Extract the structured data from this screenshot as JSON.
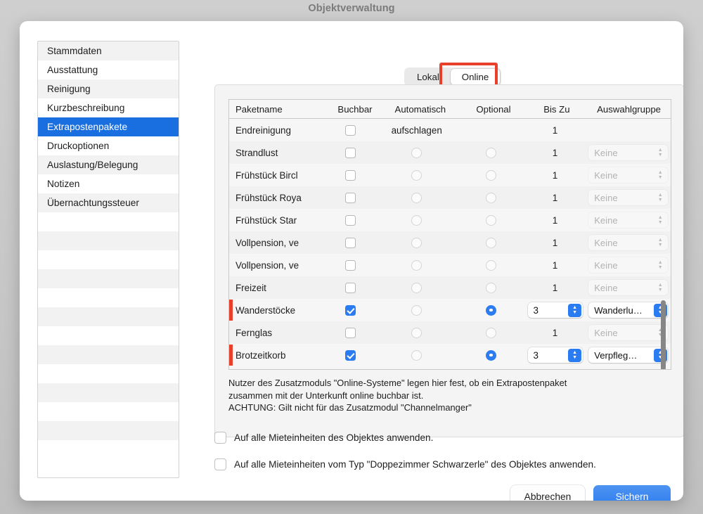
{
  "window": {
    "title": "Objektverwaltung"
  },
  "sidebar": {
    "items": [
      {
        "label": "Stammdaten",
        "selected": false
      },
      {
        "label": "Ausstattung",
        "selected": false
      },
      {
        "label": "Reinigung",
        "selected": false
      },
      {
        "label": "Kurzbeschreibung",
        "selected": false
      },
      {
        "label": "Extrapostenpakete",
        "selected": true
      },
      {
        "label": "Druckoptionen",
        "selected": false
      },
      {
        "label": "Auslastung/Belegung",
        "selected": false
      },
      {
        "label": "Notizen",
        "selected": false
      },
      {
        "label": "Übernachtungssteuer",
        "selected": false
      }
    ],
    "empty_rows": 13
  },
  "tabs": {
    "items": [
      {
        "label": "Lokal",
        "active": false
      },
      {
        "label": "Online",
        "active": true
      }
    ],
    "highlight_color": "#e8402a",
    "highlighted_tab": "Online"
  },
  "table": {
    "columns": [
      "Paketname",
      "Buchbar",
      "Automatisch",
      "Optional",
      "Bis Zu",
      "Auswahlgruppe"
    ],
    "rows": [
      {
        "name": "Endreinigung",
        "buchbar": false,
        "automatisch": "aufschlagen",
        "optional": null,
        "bis_zu": "1",
        "bis_zu_stepper": false,
        "gruppe": null,
        "gruppe_enabled": false,
        "marked": false
      },
      {
        "name": "Strandlust",
        "buchbar": false,
        "automatisch": "radio-off",
        "optional": "off",
        "bis_zu": "1",
        "bis_zu_stepper": false,
        "gruppe": "Keine",
        "gruppe_enabled": false,
        "marked": false
      },
      {
        "name": "Frühstück Bircl",
        "buchbar": false,
        "automatisch": "radio-off",
        "optional": "off",
        "bis_zu": "1",
        "bis_zu_stepper": false,
        "gruppe": "Keine",
        "gruppe_enabled": false,
        "marked": false
      },
      {
        "name": "Frühstück Roya",
        "buchbar": false,
        "automatisch": "radio-off",
        "optional": "off",
        "bis_zu": "1",
        "bis_zu_stepper": false,
        "gruppe": "Keine",
        "gruppe_enabled": false,
        "marked": false
      },
      {
        "name": "Frühstück Star",
        "buchbar": false,
        "automatisch": "radio-off",
        "optional": "off",
        "bis_zu": "1",
        "bis_zu_stepper": false,
        "gruppe": "Keine",
        "gruppe_enabled": false,
        "marked": false
      },
      {
        "name": "Vollpension, ve",
        "buchbar": false,
        "automatisch": "radio-off",
        "optional": "off",
        "bis_zu": "1",
        "bis_zu_stepper": false,
        "gruppe": "Keine",
        "gruppe_enabled": false,
        "marked": false
      },
      {
        "name": "Vollpension, ve",
        "buchbar": false,
        "automatisch": "radio-off",
        "optional": "off",
        "bis_zu": "1",
        "bis_zu_stepper": false,
        "gruppe": "Keine",
        "gruppe_enabled": false,
        "marked": false
      },
      {
        "name": "Freizeit",
        "buchbar": false,
        "automatisch": "radio-off",
        "optional": "off",
        "bis_zu": "1",
        "bis_zu_stepper": false,
        "gruppe": "Keine",
        "gruppe_enabled": false,
        "marked": false
      },
      {
        "name": "Wanderstöcke",
        "buchbar": true,
        "automatisch": "radio-off",
        "optional": "on",
        "bis_zu": "3",
        "bis_zu_stepper": true,
        "gruppe": "Wanderlu…",
        "gruppe_enabled": true,
        "marked": true
      },
      {
        "name": "Fernglas",
        "buchbar": false,
        "automatisch": "radio-off",
        "optional": "off",
        "bis_zu": "1",
        "bis_zu_stepper": false,
        "gruppe": "Keine",
        "gruppe_enabled": false,
        "marked": false
      },
      {
        "name": "Brotzeitkorb",
        "buchbar": true,
        "automatisch": "radio-off",
        "optional": "on",
        "bis_zu": "3",
        "bis_zu_stepper": true,
        "gruppe": "Verpfleg…",
        "gruppe_enabled": true,
        "marked": true
      }
    ]
  },
  "note": {
    "line1": "Nutzer des Zusatzmoduls \"Online-Systeme\" legen hier fest, ob ein Extrapostenpaket",
    "line2": "zusammen mit der Unterkunft online buchbar ist.",
    "line3": "ACHTUNG: Gilt nicht für das Zusatzmodul \"Channelmanger\""
  },
  "bottom_options": [
    {
      "label": "Auf alle Mieteinheiten des Objektes anwenden.",
      "checked": false
    },
    {
      "label": "Auf alle Mieteinheiten vom Typ \"Doppezimmer Schwarzerle\" des Objektes anwenden.",
      "checked": false
    }
  ],
  "footer": {
    "cancel_label": "Abbrechen",
    "save_label": "Sichern",
    "accent_color": "#2b7cf0"
  }
}
